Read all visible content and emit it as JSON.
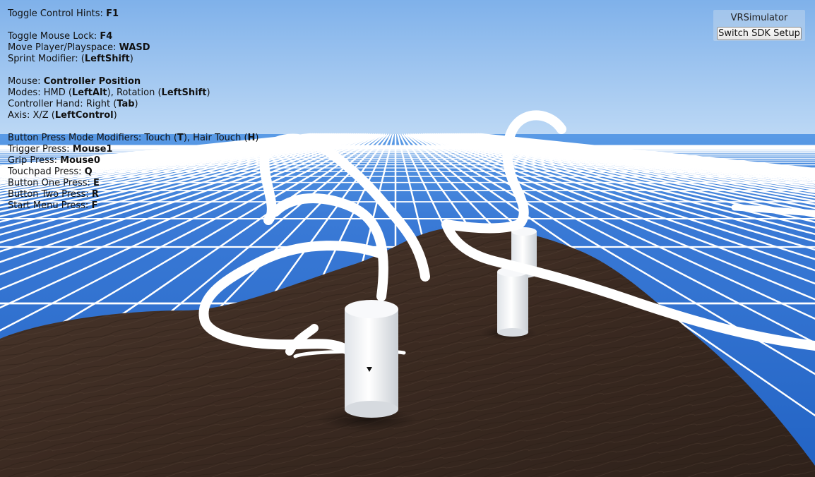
{
  "hud": {
    "lines": [
      {
        "label": "Toggle Control Hints: ",
        "key": "F1",
        "suffix": ""
      },
      null,
      {
        "label": "Toggle Mouse Lock: ",
        "key": "F4",
        "suffix": ""
      },
      {
        "label": "Move Player/Playspace: ",
        "key": "WASD",
        "suffix": ""
      },
      {
        "label": "Sprint Modifier: (",
        "key": "LeftShift",
        "suffix": ")"
      },
      null,
      {
        "label": "Mouse: ",
        "key": "Controller Position",
        "suffix": ""
      },
      {
        "label": "Modes: HMD (",
        "key": "LeftAlt",
        "suffix": "), Rotation (",
        "key2": "LeftShift",
        "suffix2": ")"
      },
      {
        "label": "Controller Hand: Right (",
        "key": "Tab",
        "suffix": ")"
      },
      {
        "label": "Axis: X/Z (",
        "key": "LeftControl",
        "suffix": ")"
      },
      null,
      {
        "label": "Button Press Mode Modifiers: Touch (",
        "key": "T",
        "suffix": "), Hair Touch (",
        "key2": "H",
        "suffix2": ")"
      },
      {
        "label": "Trigger Press: ",
        "key": "Mouse1",
        "suffix": ""
      },
      {
        "label": "Grip Press: ",
        "key": "Mouse0",
        "suffix": ""
      },
      {
        "label": "Touchpad Press: ",
        "key": "Q",
        "suffix": ""
      },
      {
        "label": "Button One Press: ",
        "key": "E",
        "suffix": ""
      },
      {
        "label": "Button Two Press: ",
        "key": "R",
        "suffix": ""
      },
      {
        "label": "Start Menu Press: ",
        "key": "F",
        "suffix": ""
      }
    ]
  },
  "vr_panel": {
    "title": "VRSimulator",
    "button_label": "Switch SDK Setup"
  },
  "colors": {
    "sky_top": "#7fb1ea",
    "sky_horizon": "#b9d6f4",
    "floor_near": "#2a69c7",
    "floor_far": "#4b8fe0",
    "grid_line": "#ffffff",
    "terrain": "#3a2a22",
    "paint_stroke": "#ffffff",
    "cylinder": "#f2f4f6"
  }
}
